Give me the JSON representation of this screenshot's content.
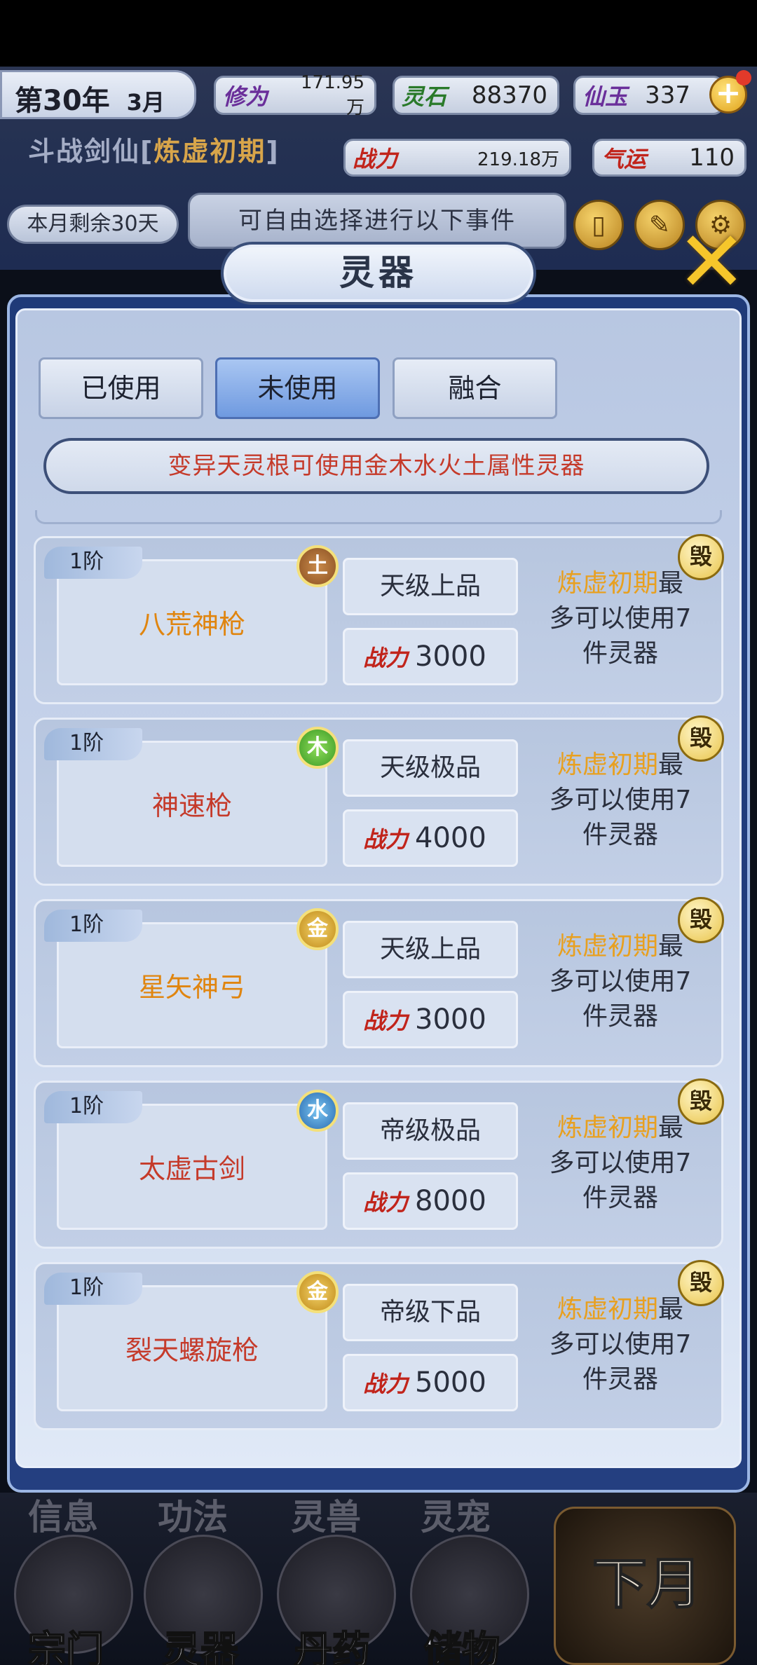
{
  "hud": {
    "year": "第30年",
    "month": "3月",
    "cultivation_label": "修为",
    "cultivation_value": "171.95万",
    "spirit_stone_label": "灵石",
    "spirit_stone_value": "88370",
    "jade_label": "仙玉",
    "jade_value": "337",
    "plus": "+",
    "sect_name": "斗战剑仙[",
    "sect_realm": "炼虚初期",
    "sect_close": "]",
    "power_label": "战力",
    "power_value": "219.18万",
    "luck_label": "气运",
    "luck_value": "110",
    "days_left": "本月剩余30天",
    "free_events": "可自由选择进行以下事件"
  },
  "panel": {
    "title": "灵器",
    "close": "✕"
  },
  "tabs": [
    {
      "label": "已使用",
      "active": false
    },
    {
      "label": "未使用",
      "active": true
    },
    {
      "label": "融合",
      "active": false
    }
  ],
  "banner": "变异天灵根可使用金木水火土属性灵器",
  "items": [
    {
      "tier": "1阶",
      "element": "土",
      "name": "八荒神枪",
      "grade": "天级上品",
      "power_label": "战力",
      "power": "3000",
      "realm": "炼虚初期",
      "desc_tail1": "最",
      "desc_line2": "多可以使用7",
      "desc_line3": "件灵器",
      "destroy": "毁"
    },
    {
      "tier": "1阶",
      "element": "木",
      "name": "神速枪",
      "grade": "天级极品",
      "power_label": "战力",
      "power": "4000",
      "realm": "炼虚初期",
      "desc_tail1": "最",
      "desc_line2": "多可以使用7",
      "desc_line3": "件灵器",
      "destroy": "毁"
    },
    {
      "tier": "1阶",
      "element": "金",
      "name": "星矢神弓",
      "grade": "天级上品",
      "power_label": "战力",
      "power": "3000",
      "realm": "炼虚初期",
      "desc_tail1": "最",
      "desc_line2": "多可以使用7",
      "desc_line3": "件灵器",
      "destroy": "毁"
    },
    {
      "tier": "1阶",
      "element": "水",
      "name": "太虚古剑",
      "grade": "帝级极品",
      "power_label": "战力",
      "power": "8000",
      "realm": "炼虚初期",
      "desc_tail1": "最",
      "desc_line2": "多可以使用7",
      "desc_line3": "件灵器",
      "destroy": "毁"
    },
    {
      "tier": "1阶",
      "element": "金",
      "name": "裂天螺旋枪",
      "grade": "帝级下品",
      "power_label": "战力",
      "power": "5000",
      "realm": "炼虚初期",
      "desc_tail1": "最",
      "desc_line2": "多可以使用7",
      "desc_line3": "件灵器",
      "destroy": "毁"
    }
  ],
  "bottom_nav": {
    "ghost_labels": [
      "信息",
      "功法",
      "灵兽",
      "灵宠"
    ],
    "items": [
      "宗门",
      "灵器",
      "丹药",
      "储物"
    ],
    "next_month": "下月"
  }
}
